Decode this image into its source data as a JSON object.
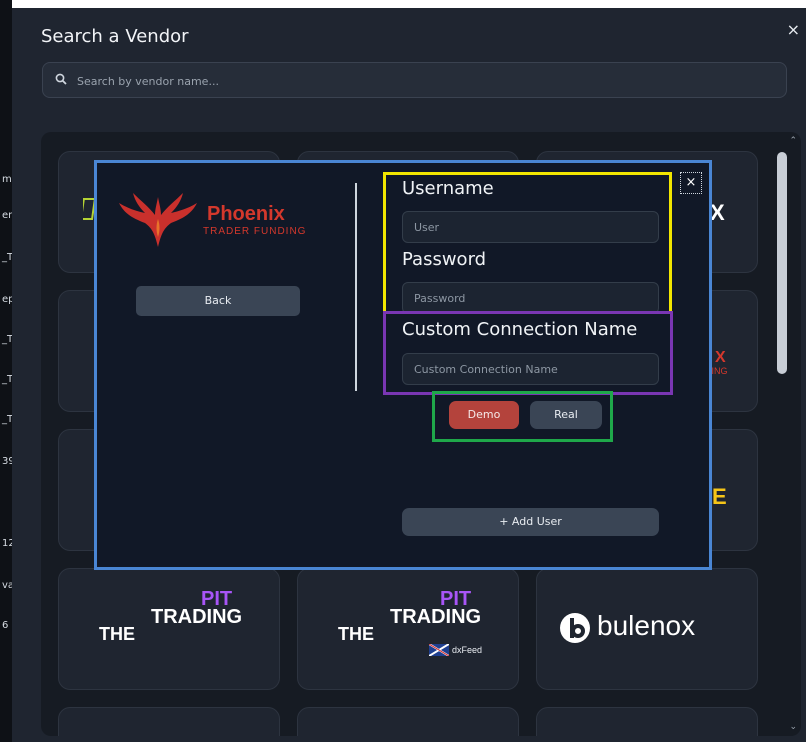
{
  "background_strip": {
    "fragments": [
      "m",
      "er",
      "_Ti",
      "ep",
      "_Ti",
      "_Ti",
      "_Ti",
      "39:",
      "12",
      "va",
      "6"
    ]
  },
  "header": {
    "title": "Search a Vendor",
    "close_glyph": "×"
  },
  "search": {
    "placeholder": "Search by vendor name..."
  },
  "vendors": {
    "the_trading_pit_1": {
      "pit": "PIT",
      "trading": "TRADING",
      "the": "THE"
    },
    "the_trading_pit_2": {
      "pit": "PIT",
      "trading": "TRADING",
      "the": "THE",
      "badge": "dxFeed"
    },
    "bulenox": {
      "name": "bulenox"
    },
    "partial_right_top": "X",
    "partial_right_mid": "X",
    "partial_right_mid_sub": "DING",
    "partial_right_low": "E"
  },
  "modal": {
    "close_glyph": "×",
    "logo": {
      "name": "Phoenix",
      "tagline": "TRADER FUNDING"
    },
    "back_button": "Back",
    "username_label": "Username",
    "username_placeholder": "User",
    "password_label": "Password",
    "password_placeholder": "Password",
    "custom_label": "Custom Connection Name",
    "custom_placeholder": "Custom Connection Name",
    "demo_button": "Demo",
    "real_button": "Real",
    "add_user_button": "+ Add User"
  },
  "colors": {
    "highlight_modal": "#4a86d4",
    "highlight_credentials": "#f2e600",
    "highlight_custom_name": "#7a36b3",
    "highlight_account_type": "#1fa84a",
    "demo_button": "#b4433c",
    "brand_phoenix": "#d4382c",
    "brand_pit": "#a855f7"
  }
}
